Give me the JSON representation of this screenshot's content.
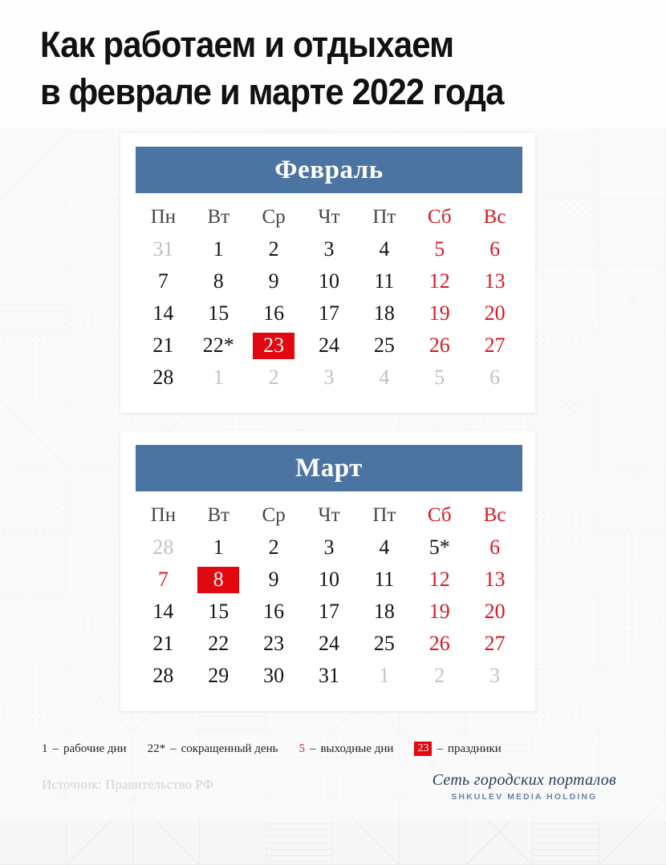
{
  "headline": "Как работаем и отдыхаем\nв феврале и марте 2022 года",
  "colors": {
    "header_blue": "#4b74a2",
    "holiday_red": "#e3080f",
    "weekend_red": "#d61a23",
    "out_gray": "#c2c2c2",
    "background": "#f6f6f6",
    "logo_navy": "#2b3e5c",
    "logo_blue": "#6c84a8"
  },
  "calendars": [
    {
      "month": "Февраль",
      "dow": [
        "Пн",
        "Вт",
        "Ср",
        "Чт",
        "Пт",
        "Сб",
        "Вс"
      ],
      "weeks": [
        [
          {
            "t": "31",
            "k": "out"
          },
          {
            "t": "1",
            "k": "work"
          },
          {
            "t": "2",
            "k": "work"
          },
          {
            "t": "3",
            "k": "work"
          },
          {
            "t": "4",
            "k": "work"
          },
          {
            "t": "5",
            "k": "off"
          },
          {
            "t": "6",
            "k": "off"
          }
        ],
        [
          {
            "t": "7",
            "k": "work"
          },
          {
            "t": "8",
            "k": "work"
          },
          {
            "t": "9",
            "k": "work"
          },
          {
            "t": "10",
            "k": "work"
          },
          {
            "t": "11",
            "k": "work"
          },
          {
            "t": "12",
            "k": "off"
          },
          {
            "t": "13",
            "k": "off"
          }
        ],
        [
          {
            "t": "14",
            "k": "work"
          },
          {
            "t": "15",
            "k": "work"
          },
          {
            "t": "16",
            "k": "work"
          },
          {
            "t": "17",
            "k": "work"
          },
          {
            "t": "18",
            "k": "work"
          },
          {
            "t": "19",
            "k": "off"
          },
          {
            "t": "20",
            "k": "off"
          }
        ],
        [
          {
            "t": "21",
            "k": "work"
          },
          {
            "t": "22*",
            "k": "short"
          },
          {
            "t": "23",
            "k": "holiday"
          },
          {
            "t": "24",
            "k": "work"
          },
          {
            "t": "25",
            "k": "work"
          },
          {
            "t": "26",
            "k": "off"
          },
          {
            "t": "27",
            "k": "off"
          }
        ],
        [
          {
            "t": "28",
            "k": "work"
          },
          {
            "t": "1",
            "k": "out"
          },
          {
            "t": "2",
            "k": "out"
          },
          {
            "t": "3",
            "k": "out"
          },
          {
            "t": "4",
            "k": "out"
          },
          {
            "t": "5",
            "k": "out"
          },
          {
            "t": "6",
            "k": "out"
          }
        ]
      ]
    },
    {
      "month": "Март",
      "dow": [
        "Пн",
        "Вт",
        "Ср",
        "Чт",
        "Пт",
        "Сб",
        "Вс"
      ],
      "weeks": [
        [
          {
            "t": "28",
            "k": "out"
          },
          {
            "t": "1",
            "k": "work"
          },
          {
            "t": "2",
            "k": "work"
          },
          {
            "t": "3",
            "k": "work"
          },
          {
            "t": "4",
            "k": "work"
          },
          {
            "t": "5*",
            "k": "short"
          },
          {
            "t": "6",
            "k": "off"
          }
        ],
        [
          {
            "t": "7",
            "k": "off"
          },
          {
            "t": "8",
            "k": "holiday"
          },
          {
            "t": "9",
            "k": "work"
          },
          {
            "t": "10",
            "k": "work"
          },
          {
            "t": "11",
            "k": "work"
          },
          {
            "t": "12",
            "k": "off"
          },
          {
            "t": "13",
            "k": "off"
          }
        ],
        [
          {
            "t": "14",
            "k": "work"
          },
          {
            "t": "15",
            "k": "work"
          },
          {
            "t": "16",
            "k": "work"
          },
          {
            "t": "17",
            "k": "work"
          },
          {
            "t": "18",
            "k": "work"
          },
          {
            "t": "19",
            "k": "off"
          },
          {
            "t": "20",
            "k": "off"
          }
        ],
        [
          {
            "t": "21",
            "k": "work"
          },
          {
            "t": "22",
            "k": "work"
          },
          {
            "t": "23",
            "k": "work"
          },
          {
            "t": "24",
            "k": "work"
          },
          {
            "t": "25",
            "k": "work"
          },
          {
            "t": "26",
            "k": "off"
          },
          {
            "t": "27",
            "k": "off"
          }
        ],
        [
          {
            "t": "28",
            "k": "work"
          },
          {
            "t": "29",
            "k": "work"
          },
          {
            "t": "30",
            "k": "work"
          },
          {
            "t": "31",
            "k": "work"
          },
          {
            "t": "1",
            "k": "out"
          },
          {
            "t": "2",
            "k": "out"
          },
          {
            "t": "3",
            "k": "out"
          }
        ]
      ]
    }
  ],
  "legend": [
    {
      "key": "1",
      "style": "work",
      "dash": "–",
      "label": "рабочие дни"
    },
    {
      "key": "22*",
      "style": "work",
      "dash": "–",
      "label": "сокращенный день"
    },
    {
      "key": "5",
      "style": "off",
      "dash": "–",
      "label": "выходные дни"
    },
    {
      "key": "23",
      "style": "holiday",
      "dash": "–",
      "label": "праздники"
    }
  ],
  "footer": {
    "source": "Источник: Правительство РФ",
    "logo_script": "Сеть городских порталов",
    "logo_sub": "SHKULEV MEDIA HOLDING"
  }
}
